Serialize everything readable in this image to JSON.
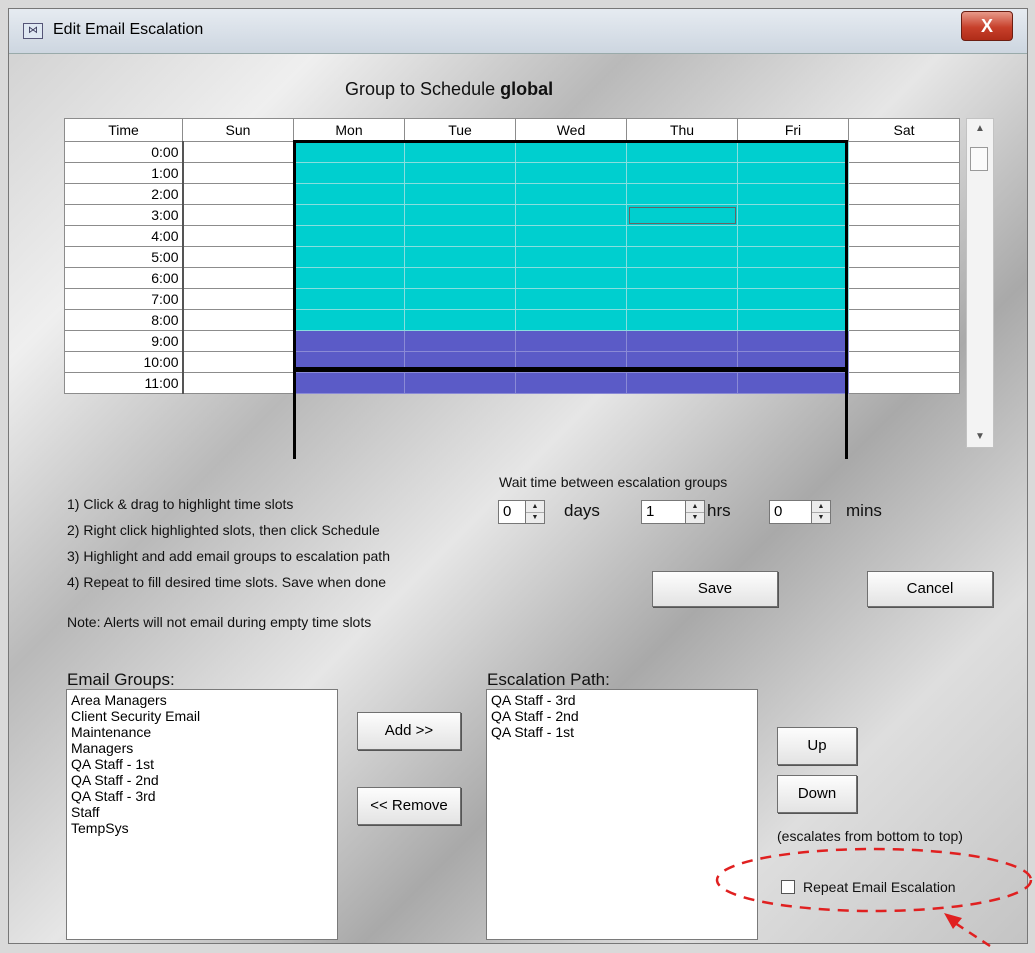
{
  "window": {
    "title": "Edit Email Escalation",
    "close_glyph": "X"
  },
  "heading": {
    "prefix": "Group  to Schedule",
    "group": "global"
  },
  "schedule": {
    "columns": [
      "Time",
      "Sun",
      "Mon",
      "Tue",
      "Wed",
      "Thu",
      "Fri",
      "Sat"
    ],
    "times": [
      "0:00",
      "1:00",
      "2:00",
      "3:00",
      "4:00",
      "5:00",
      "6:00",
      "7:00",
      "8:00",
      "9:00",
      "10:00",
      "11:00"
    ],
    "colors": {
      "escalation_a": "#00cfcf",
      "escalation_b": "#5b5bc7",
      "empty": "#ffffff"
    }
  },
  "instructions": [
    "1) Click & drag to highlight time slots",
    "2) Right click highlighted slots, then click Schedule",
    "3) Highlight and add email groups to escalation path",
    "4) Repeat to fill desired time slots. Save when done"
  ],
  "note": "Note: Alerts will not email during empty time slots",
  "wait": {
    "label": "Wait time between escalation groups",
    "days_value": "0",
    "days_unit": "days",
    "hrs_value": "1",
    "hrs_unit": "hrs",
    "mins_value": "0",
    "mins_unit": "mins"
  },
  "buttons": {
    "save": "Save",
    "cancel": "Cancel",
    "add": "Add >>",
    "remove": "<< Remove",
    "up": "Up",
    "down": "Down"
  },
  "email_groups": {
    "label": "Email Groups:",
    "items": [
      "Area Managers",
      "Client Security Email",
      "Maintenance",
      "Managers",
      "QA Staff - 1st",
      "QA Staff - 2nd",
      "QA Staff - 3rd",
      "Staff",
      "TempSys"
    ]
  },
  "escalation_path": {
    "label": "Escalation Path:",
    "items": [
      "QA Staff - 3rd",
      "QA Staff - 2nd",
      "QA Staff - 1st"
    ]
  },
  "escalates_note": "(escalates from bottom to top)",
  "repeat": {
    "label": "Repeat Email Escalation",
    "checked": false
  },
  "annotation_color": "#e02020"
}
